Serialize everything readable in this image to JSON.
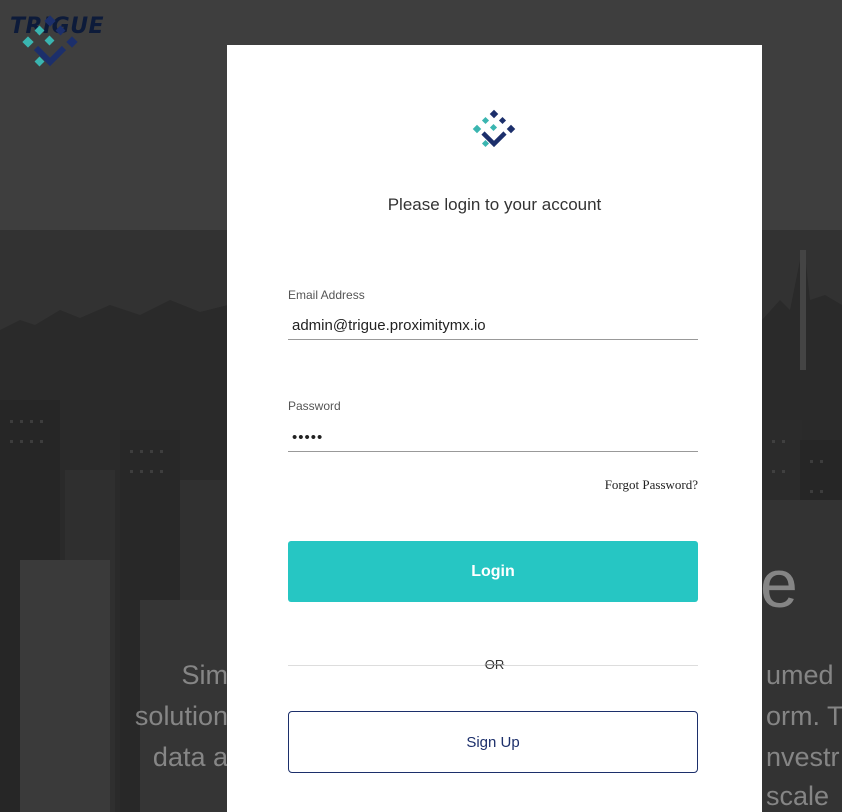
{
  "brand": {
    "name": "TRIGUE",
    "logo_icon": "trigue-diamond-logo"
  },
  "background": {
    "big_char": "e",
    "lines_left": [
      "Sim",
      "solution",
      "data a"
    ],
    "lines_right": [
      "umed",
      "orm. T",
      "nvestr",
      "scale"
    ]
  },
  "login": {
    "heading": "Please login to your account",
    "email_label": "Email Address",
    "email_value": "admin@trigue.proximitymx.io",
    "password_label": "Password",
    "password_value": "•••••",
    "forgot_label": "Forgot Password?",
    "login_label": "Login",
    "or_label": "OR",
    "signup_label": "Sign Up"
  },
  "colors": {
    "accent": "#26c6c3",
    "navy": "#1c2f6b",
    "teal": "#3ab5b0"
  }
}
